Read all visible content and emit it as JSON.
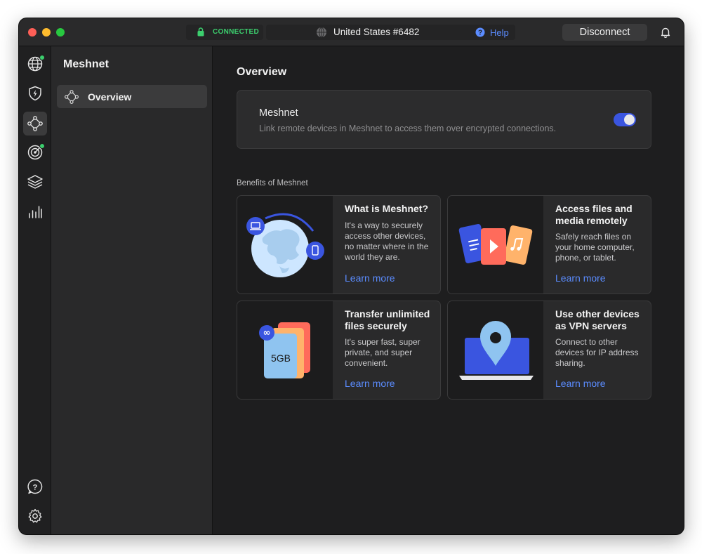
{
  "titlebar": {
    "status": "CONNECTED",
    "server": "United States #6482",
    "help": "Help",
    "disconnect": "Disconnect"
  },
  "rail": {
    "items": [
      {
        "icon": "globe-icon",
        "badge": true
      },
      {
        "icon": "shield-bolt-icon"
      },
      {
        "icon": "meshnet-icon",
        "active": true
      },
      {
        "icon": "radar-icon",
        "badge": true
      },
      {
        "icon": "layers-icon"
      },
      {
        "icon": "bar-chart-icon"
      },
      {
        "icon": "help-chat-icon"
      },
      {
        "icon": "gear-icon"
      }
    ]
  },
  "sidebar": {
    "title": "Meshnet",
    "items": [
      {
        "label": "Overview",
        "icon": "meshnet-icon"
      }
    ]
  },
  "main": {
    "title": "Overview",
    "toggle_card": {
      "title": "Meshnet",
      "description": "Link remote devices in Meshnet to access them over encrypted connections.",
      "enabled": true
    },
    "benefits_label": "Benefits of Meshnet",
    "cards": [
      {
        "title": "What is Meshnet?",
        "description": "It's a way to securely access other devices, no matter where in the world they are.",
        "link": "Learn more"
      },
      {
        "title": "Access files and media remotely",
        "description": "Safely reach files on your home computer, phone, or tablet.",
        "link": "Learn more"
      },
      {
        "title": "Transfer unlimited files securely",
        "description": "It's super fast, super private, and super convenient.",
        "link": "Learn more",
        "art_label": "5GB"
      },
      {
        "title": "Use other devices as VPN servers",
        "description": "Connect to other devices for IP address sharing.",
        "link": "Learn more"
      }
    ]
  },
  "colors": {
    "accent": "#5b8cff",
    "connected": "#3ccf6e",
    "toggle_on": "#3a55e0"
  }
}
